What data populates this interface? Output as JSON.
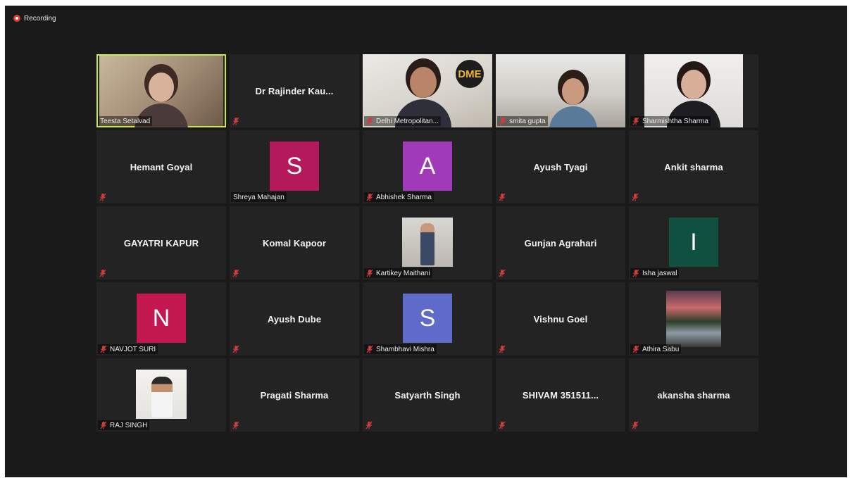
{
  "recording": {
    "label": "Recording"
  },
  "colors": {
    "active_speaker_border": "#c6e94a",
    "mute_icon": "#d13b3b",
    "tile_bg": "#232323",
    "stage_bg": "#1a1a1a"
  },
  "participants": [
    {
      "name": "Teesta Setalvad",
      "display": "video",
      "active": true
    },
    {
      "name": "Dr Rajinder Kau...",
      "display": "name"
    },
    {
      "name": "Delhi Metropolitan...",
      "display": "video",
      "logo": "DME"
    },
    {
      "name": "smita gupta",
      "display": "video"
    },
    {
      "name": "Sharmishtha Sharma",
      "display": "video"
    },
    {
      "name": "Hemant Goyal",
      "display": "name"
    },
    {
      "name": "Shreya Mahajan",
      "display": "avatar",
      "initial": "S",
      "avatar_color": "#b3195b",
      "muted": false
    },
    {
      "name": "Abhishek Sharma",
      "display": "avatar",
      "initial": "A",
      "avatar_color": "#a03ab8"
    },
    {
      "name": "Ayush Tyagi",
      "display": "name"
    },
    {
      "name": "Ankit sharma",
      "display": "name"
    },
    {
      "name": "GAYATRI KAPUR",
      "display": "name"
    },
    {
      "name": "Komal Kapoor",
      "display": "name"
    },
    {
      "name": "Kartikey Maithani",
      "display": "photo",
      "photo": "person-in-suit"
    },
    {
      "name": "Gunjan Agrahari",
      "display": "name"
    },
    {
      "name": "Isha jaswal",
      "display": "avatar",
      "initial": "I",
      "avatar_color": "#0f5041"
    },
    {
      "name": "NAVJOT SURI",
      "display": "avatar",
      "initial": "N",
      "avatar_color": "#c2174f"
    },
    {
      "name": "Ayush Dube",
      "display": "name"
    },
    {
      "name": "Shambhavi Mishra",
      "display": "avatar",
      "initial": "S",
      "avatar_color": "#5e6bc9"
    },
    {
      "name": "Vishnu Goel",
      "display": "name"
    },
    {
      "name": "Athira Sabu",
      "display": "photo",
      "photo": "river-landscape"
    },
    {
      "name": "RAJ SINGH",
      "display": "photo",
      "photo": "man-with-phone"
    },
    {
      "name": "Pragati Sharma",
      "display": "name"
    },
    {
      "name": "Satyarth Singh",
      "display": "name"
    },
    {
      "name": "SHIVAM 351511...",
      "display": "name"
    },
    {
      "name": "akansha sharma",
      "display": "name"
    }
  ]
}
